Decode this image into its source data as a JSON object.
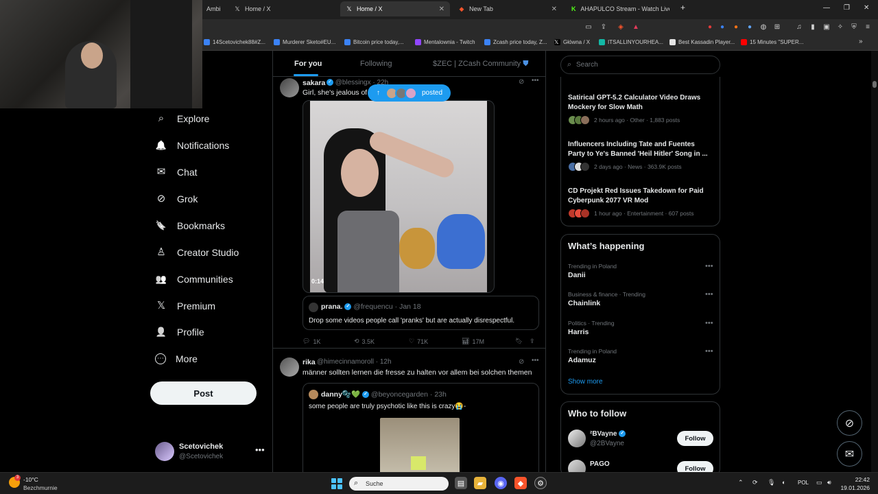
{
  "browser": {
    "tabs": [
      {
        "label": "Ambi",
        "active": false
      },
      {
        "label": "Home / X",
        "active": false
      },
      {
        "label": "Home / X",
        "active": true
      },
      {
        "label": "New Tab",
        "active": false
      },
      {
        "label": "AHAPULCO Stream - Watch Live on K",
        "active": false
      }
    ],
    "new_tab_icon": "+",
    "bookmarks": [
      {
        "label": "14Scetovichek88#Z...",
        "color": "#3b82f6"
      },
      {
        "label": "Murderer Sketo#EU...",
        "color": "#3b82f6"
      },
      {
        "label": "Bitcoin price today,...",
        "color": "#3b82f6"
      },
      {
        "label": "Mentalownia - Twitch",
        "color": "#9146ff"
      },
      {
        "label": "Zcash price today, Z...",
        "color": "#3b82f6"
      },
      {
        "label": "Główna / X",
        "color": "#ffffff"
      },
      {
        "label": "ITSALLINYOURHEA...",
        "color": "#14b8a6"
      },
      {
        "label": "Best Kassadin Player...",
        "color": "#e5e5e5"
      },
      {
        "label": "15 Minutes \"SUPER...",
        "color": "#ff0000"
      }
    ]
  },
  "nav": {
    "items": [
      {
        "label": "Explore",
        "icon": "search-icon",
        "glyph": "⌕"
      },
      {
        "label": "Notifications",
        "icon": "bell-icon",
        "glyph": "🔔"
      },
      {
        "label": "Chat",
        "icon": "mail-icon",
        "glyph": "✉"
      },
      {
        "label": "Grok",
        "icon": "grok-icon",
        "glyph": "⊘"
      },
      {
        "label": "Bookmarks",
        "icon": "bookmark-icon",
        "glyph": "🔖"
      },
      {
        "label": "Creator Studio",
        "icon": "creator-studio-icon",
        "glyph": "♙"
      },
      {
        "label": "Communities",
        "icon": "communities-icon",
        "glyph": "👥"
      },
      {
        "label": "Premium",
        "icon": "x-logo-icon",
        "glyph": "𝕏"
      },
      {
        "label": "Profile",
        "icon": "person-icon",
        "glyph": "👤"
      },
      {
        "label": "More",
        "icon": "more-circle-icon",
        "glyph": "⋯"
      }
    ],
    "post_label": "Post",
    "user": {
      "name": "Scetovichek",
      "handle": "@Scetovichek"
    }
  },
  "feed": {
    "tabs": [
      {
        "label": "For you",
        "active": true
      },
      {
        "label": "Following",
        "active": false
      },
      {
        "label": "$ZEC | ZCash Community",
        "active": false
      }
    ],
    "posted_pill": {
      "label": "posted"
    },
    "tweets": [
      {
        "name": "sakara",
        "handle": "@blessingx",
        "time": "· 22h",
        "text": "Girl, she's jealous of y",
        "video_duration": "0:14",
        "quote": {
          "name": "prana.",
          "handle": "@frequencu",
          "time": "· Jan 18",
          "text": "Drop some videos people call 'pranks' but are actually disrespectful."
        },
        "stats": {
          "replies": "1K",
          "reposts": "3.5K",
          "likes": "71K",
          "views": "17M"
        }
      },
      {
        "name": "rika",
        "handle": "@himecinnamoroll",
        "time": "· 12h",
        "text": "männer sollten lernen die fresse zu halten vor allem bei solchen themen",
        "quote": {
          "name": "danny🫧💚",
          "handle": "@beyoncegarden",
          "time": "· 23h",
          "text": "some people are truly psychotic like this is crazy😭-"
        }
      }
    ]
  },
  "sidebar": {
    "search_placeholder": "Search",
    "news": [
      {
        "title": "Satirical GPT-5.2 Calculator Video Draws Mockery for Slow Math",
        "meta": "2 hours ago · Other · 1,883 posts"
      },
      {
        "title": "Influencers Including Tate and Fuentes Party to Ye's Banned 'Heil Hitler' Song in ...",
        "meta": "2 days ago · News · 363.9K posts"
      },
      {
        "title": "CD Projekt Red Issues Takedown for Paid Cyberpunk 2077 VR Mod",
        "meta": "1 hour ago · Entertainment · 607 posts"
      }
    ],
    "happening_title": "What’s happening",
    "trends": [
      {
        "category": "Trending in Poland",
        "name": "Danii"
      },
      {
        "category": "Business & finance · Trending",
        "name": "Chainlink"
      },
      {
        "category": "Politics · Trending",
        "name": "Harris"
      },
      {
        "category": "Trending in Poland",
        "name": "Adamuz"
      }
    ],
    "show_more": "Show more",
    "wtf_title": "Who to follow",
    "follow": [
      {
        "name": "²BVayne",
        "handle": "@2BVayne",
        "button": "Follow"
      },
      {
        "name": "PAGO",
        "handle": "",
        "button": "Follow"
      }
    ]
  },
  "taskbar": {
    "weather": {
      "temp": "-10°C",
      "desc": "Bezchmurnie",
      "badge": "3"
    },
    "search_placeholder": "Suche",
    "lang": "POL",
    "time": "22:42",
    "date": "19.01.2026"
  }
}
